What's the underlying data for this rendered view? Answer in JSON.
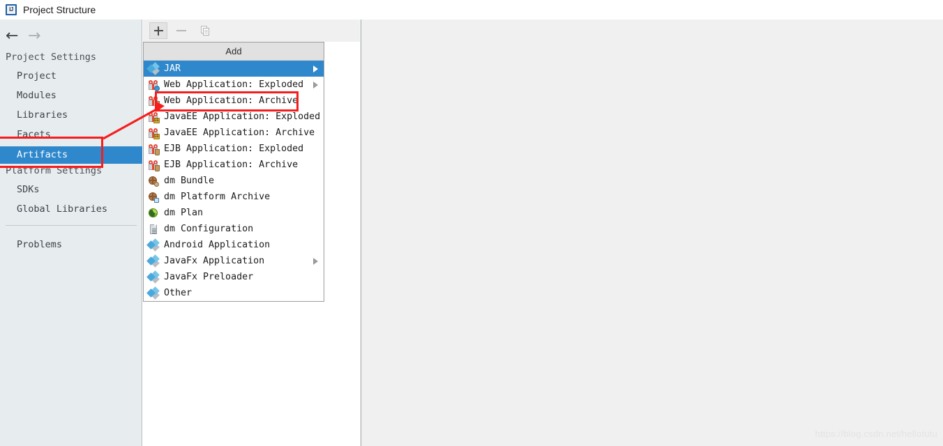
{
  "window": {
    "title": "Project Structure",
    "app_icon": "intellij-idea-icon"
  },
  "navigation": {
    "back_icon": "arrow-left-icon",
    "forward_icon": "arrow-right-icon"
  },
  "sidebar": {
    "groups": [
      {
        "title": "Project Settings",
        "items": [
          {
            "label": "Project",
            "selected": false
          },
          {
            "label": "Modules",
            "selected": false
          },
          {
            "label": "Libraries",
            "selected": false
          },
          {
            "label": "Facets",
            "selected": false
          },
          {
            "label": "Artifacts",
            "selected": true
          }
        ]
      },
      {
        "title": "Platform Settings",
        "items": [
          {
            "label": "SDKs",
            "selected": false
          },
          {
            "label": "Global Libraries",
            "selected": false
          }
        ]
      }
    ],
    "footer_items": [
      {
        "label": "Problems",
        "selected": false
      }
    ],
    "selected_color": "#2f88cc"
  },
  "toolbar": {
    "buttons": [
      {
        "name": "add-button",
        "icon": "plus-icon",
        "enabled": true,
        "active": true
      },
      {
        "name": "remove-button",
        "icon": "minus-icon",
        "enabled": false,
        "active": false
      },
      {
        "name": "copy-button",
        "icon": "copy-icon",
        "enabled": false,
        "active": false
      }
    ]
  },
  "popup_menu": {
    "header": "Add",
    "highlight_color": "#2f88cc",
    "items": [
      {
        "label": "JAR",
        "icon": "blue-diamond-icon",
        "submenu": true,
        "highlighted": true
      },
      {
        "label": "Web Application: Exploded",
        "icon": "gift-box-web-icon",
        "submenu": true,
        "highlighted": false
      },
      {
        "label": "Web Application: Archive",
        "icon": "gift-box-web-icon",
        "submenu": false,
        "highlighted": false
      },
      {
        "label": "JavaEE Application: Exploded",
        "icon": "gift-box-ee-icon",
        "submenu": false,
        "highlighted": false
      },
      {
        "label": "JavaEE Application: Archive",
        "icon": "gift-box-ee-icon",
        "submenu": false,
        "highlighted": false
      },
      {
        "label": "EJB Application: Exploded",
        "icon": "gift-box-ejb-icon",
        "submenu": false,
        "highlighted": false
      },
      {
        "label": "EJB Application: Archive",
        "icon": "gift-box-ejb-icon",
        "submenu": false,
        "highlighted": false
      },
      {
        "label": "dm Bundle",
        "icon": "dm-sphere-icon",
        "submenu": false,
        "highlighted": false
      },
      {
        "label": "dm Platform Archive",
        "icon": "dm-sphere-icon",
        "submenu": false,
        "highlighted": false
      },
      {
        "label": "dm Plan",
        "icon": "green-leaf-icon",
        "submenu": false,
        "highlighted": false
      },
      {
        "label": "dm Configuration",
        "icon": "document-icon",
        "submenu": false,
        "highlighted": false
      },
      {
        "label": "Android Application",
        "icon": "blue-diamond-icon",
        "submenu": false,
        "highlighted": false
      },
      {
        "label": "JavaFx Application",
        "icon": "blue-diamond-icon",
        "submenu": true,
        "highlighted": false
      },
      {
        "label": "JavaFx Preloader",
        "icon": "blue-diamond-icon",
        "submenu": false,
        "highlighted": false
      },
      {
        "label": "Other",
        "icon": "blue-diamond-icon",
        "submenu": false,
        "highlighted": false
      }
    ]
  },
  "annotations": {
    "color": "#f61d1d",
    "boxes": [
      {
        "name": "artifacts-highlight-box",
        "target": "Artifacts"
      },
      {
        "name": "web-application-archive-highlight-box",
        "target": "Web Application: Archive"
      }
    ],
    "arrow": {
      "name": "annotation-arrow",
      "from": "artifacts-highlight-box",
      "to": "web-application-archive-highlight-box"
    }
  },
  "watermark": {
    "text": "https://blog.csdn.net/hellotutu"
  }
}
